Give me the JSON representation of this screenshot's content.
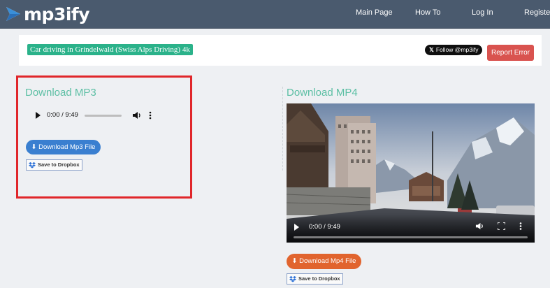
{
  "nav": {
    "logo": "mp3ify",
    "links": [
      "Main Page",
      "How To",
      "Log In",
      "Register"
    ]
  },
  "title_bar": {
    "video_title": "Car driving in Grindelwald (Swiss Alps Driving) 4k",
    "follow_label": "Follow @mp3ify",
    "report_label": "Report Error"
  },
  "mp3": {
    "heading": "Download MP3",
    "time": "0:00 / 9:49",
    "progress": 0,
    "download_label": "Download Mp3 File",
    "dropbox_label": "Save to Dropbox"
  },
  "mp4": {
    "heading": "Download MP4",
    "time": "0:00 / 9:49",
    "progress": 0,
    "download_label": "Download Mp4 File",
    "dropbox_label": "Save to Dropbox"
  },
  "colors": {
    "navbar": "#4a5a6e",
    "accent_teal": "#2bb28a",
    "heading_teal": "#5cbfa4",
    "mp3_button": "#3a7fd0",
    "mp4_button": "#e1642e",
    "report_button": "#d9534f",
    "highlight": "#e0262a"
  }
}
